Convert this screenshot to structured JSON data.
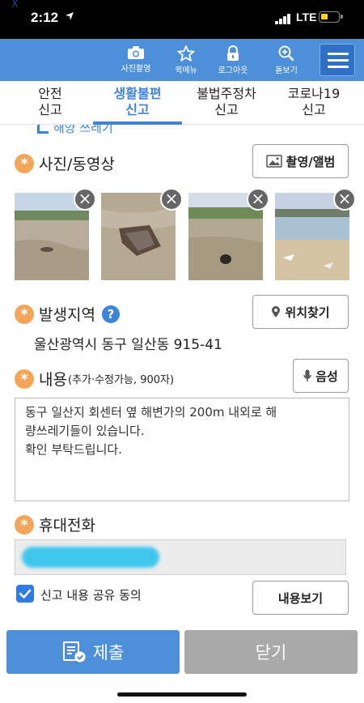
{
  "status_bar": {
    "time": "2:12",
    "network": "LTE",
    "corner_mark": "X"
  },
  "header": {
    "buttons": [
      {
        "label": "사진촬영",
        "icon": "camera-icon"
      },
      {
        "label": "퀵메뉴",
        "icon": "star-icon"
      },
      {
        "label": "로그아웃",
        "icon": "lock-icon"
      },
      {
        "label": "돋보기",
        "icon": "magnifier-plus-icon"
      }
    ],
    "menu_icon": "hamburger-icon"
  },
  "tabs": [
    {
      "line1": "안전",
      "line2": "신고",
      "active": false
    },
    {
      "line1": "생활불편",
      "line2": "신고",
      "active": true
    },
    {
      "line1": "불법주정차",
      "line2": "신고",
      "active": false
    },
    {
      "line1": "코로나19",
      "line2": "신고",
      "active": false
    }
  ],
  "form": {
    "cut_off_text": "해양 쓰레기",
    "photos": {
      "label": "사진/동영상",
      "button": "촬영/앨범",
      "button_icon": "image-icon",
      "count": 4,
      "delete_glyph": "×"
    },
    "location": {
      "label": "발생지역",
      "help": "?",
      "button": "위치찾기",
      "button_icon": "location-pin-icon",
      "address": "울산광역시 동구 일산동 915-41"
    },
    "content": {
      "label": "내용",
      "sub_label": "(추가·수정가능, 900자)",
      "voice_button": "음성",
      "voice_icon": "microphone-icon",
      "text": "동구 일산지 회센터 옆 해변가의 200m 내외로 해\n량쓰레기들이 있습니다.\n확인 부탁드립니다."
    },
    "phone": {
      "label": "휴대전화",
      "value_redacted": true
    },
    "share_consent": {
      "label": "신고 내용 공유 동의",
      "checked": true,
      "view_button": "내용보기"
    },
    "required_mark": "*"
  },
  "footer": {
    "submit": "제출",
    "submit_icon": "submit-form-icon",
    "close": "닫기"
  },
  "colors": {
    "header_blue": "#4d8fd8",
    "accent_blue": "#3d84d8",
    "required_orange": "#f4a55a",
    "close_gray": "#a9a9a9"
  }
}
